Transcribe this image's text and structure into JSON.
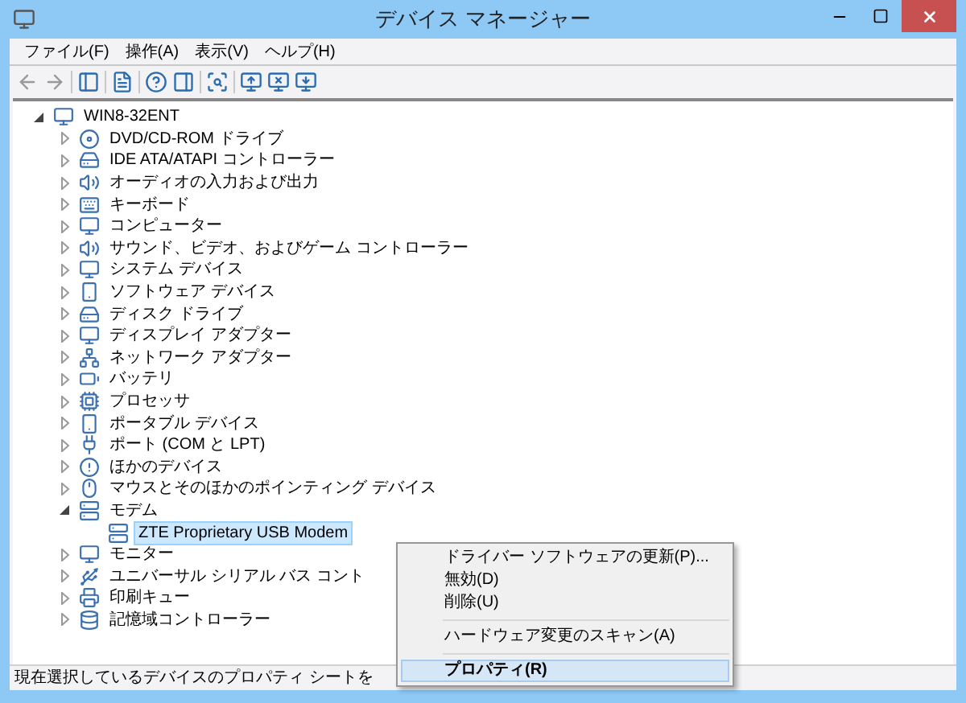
{
  "window": {
    "title": "デバイス マネージャー"
  },
  "menu": [
    "ファイル(F)",
    "操作(A)",
    "表示(V)",
    "ヘルプ(H)"
  ],
  "tree": {
    "label": "WIN8-32ENT",
    "expanded": true,
    "selected": false,
    "children": [
      {
        "label": "DVD/CD-ROM ドライブ",
        "expanded": false,
        "selected": false
      },
      {
        "label": "IDE ATA/ATAPI コントローラー",
        "expanded": false,
        "selected": false
      },
      {
        "label": "オーディオの入力および出力",
        "expanded": false,
        "selected": false
      },
      {
        "label": "キーボード",
        "expanded": false,
        "selected": false
      },
      {
        "label": "コンピューター",
        "expanded": false,
        "selected": false
      },
      {
        "label": "サウンド、ビデオ、およびゲーム コントローラー",
        "expanded": false,
        "selected": false
      },
      {
        "label": "システム デバイス",
        "expanded": false,
        "selected": false
      },
      {
        "label": "ソフトウェア デバイス",
        "expanded": false,
        "selected": false
      },
      {
        "label": "ディスク ドライブ",
        "expanded": false,
        "selected": false
      },
      {
        "label": "ディスプレイ アダプター",
        "expanded": false,
        "selected": false
      },
      {
        "label": "ネットワーク アダプター",
        "expanded": false,
        "selected": false
      },
      {
        "label": "バッテリ",
        "expanded": false,
        "selected": false
      },
      {
        "label": "プロセッサ",
        "expanded": false,
        "selected": false
      },
      {
        "label": "ポータブル デバイス",
        "expanded": false,
        "selected": false
      },
      {
        "label": "ポート (COM と LPT)",
        "expanded": false,
        "selected": false
      },
      {
        "label": "ほかのデバイス",
        "expanded": false,
        "selected": false
      },
      {
        "label": "マウスとそのほかのポインティング デバイス",
        "expanded": false,
        "selected": false
      },
      {
        "label": "モデム",
        "expanded": true,
        "selected": false,
        "children": [
          {
            "label": "ZTE Proprietary USB Modem",
            "selected": true
          }
        ]
      },
      {
        "label": "モニター",
        "expanded": false,
        "selected": false
      },
      {
        "label": "ユニバーサル シリアル バス コント",
        "expanded": false,
        "selected": false
      },
      {
        "label": "印刷キュー",
        "expanded": false,
        "selected": false
      },
      {
        "label": "記憶域コントローラー",
        "expanded": false,
        "selected": false
      }
    ]
  },
  "context_menu": [
    {
      "kind": "item",
      "label": "ドライバー ソフトウェアの更新(P)...",
      "selected": false,
      "bold": false
    },
    {
      "kind": "item",
      "label": "無効(D)",
      "selected": false,
      "bold": false
    },
    {
      "kind": "item",
      "label": "削除(U)",
      "selected": false,
      "bold": false
    },
    {
      "kind": "separator"
    },
    {
      "kind": "item",
      "label": "ハードウェア変更のスキャン(A)",
      "selected": false,
      "bold": false
    },
    {
      "kind": "separator"
    },
    {
      "kind": "item",
      "label": "プロパティ(R)",
      "selected": true,
      "bold": true
    }
  ],
  "status_bar": "現在選択しているデバイスのプロパティ シートを"
}
